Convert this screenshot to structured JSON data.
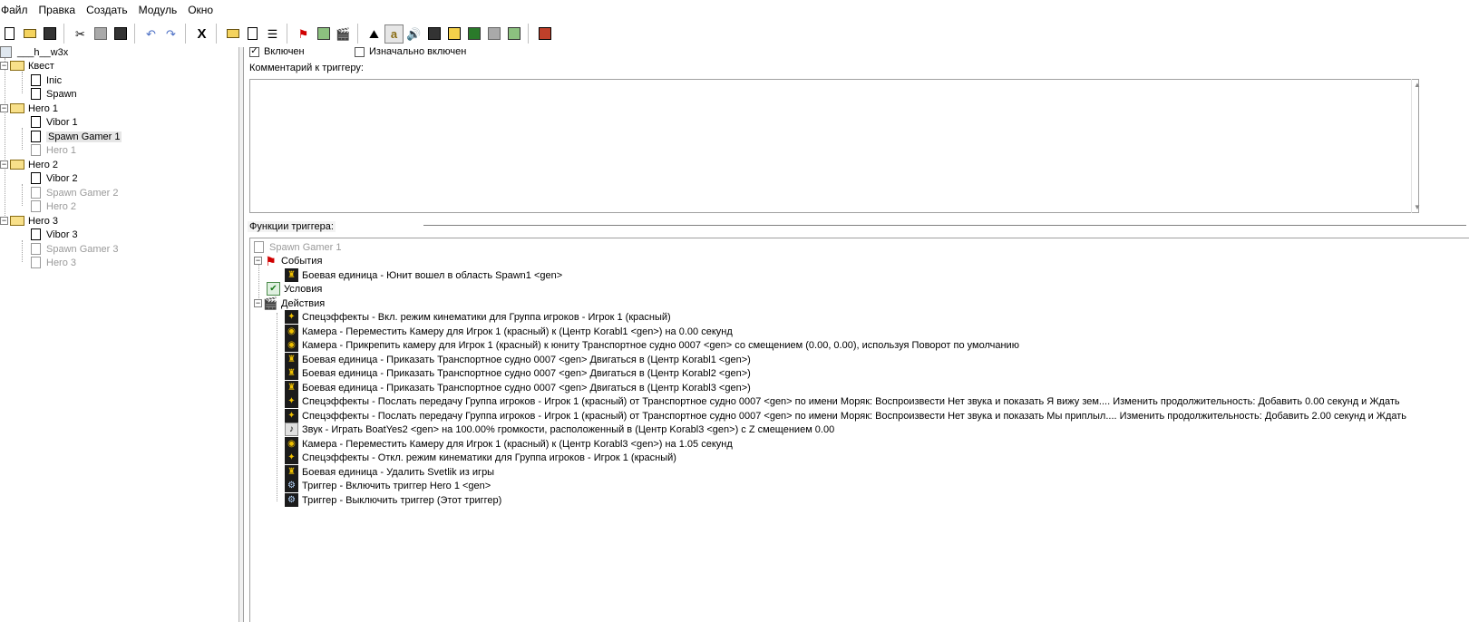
{
  "menu": [
    "Файл",
    "Правка",
    "Создать",
    "Модуль",
    "Окно"
  ],
  "toolbar_icons": [
    "new-icon",
    "open-icon",
    "save-icon",
    "cut-icon",
    "copy-icon",
    "paste-icon",
    "undo-icon",
    "redo-icon",
    "delete-icon",
    "new-category-icon",
    "new-trigger-icon",
    "new-comment-icon",
    "new-event-icon",
    "new-condition-icon",
    "new-action-icon",
    "terrain-editor-icon",
    "trigger-editor-icon",
    "sound-editor-icon",
    "object-editor-icon",
    "campaign-editor-icon",
    "ai-editor-icon",
    "object-manager-icon",
    "import-manager-icon",
    "test-map-icon"
  ],
  "tree": {
    "root": "___h__w3x",
    "categories": [
      {
        "label": "Квест",
        "items": [
          {
            "label": "Inic",
            "enabled": true
          },
          {
            "label": "Spawn",
            "enabled": true
          }
        ]
      },
      {
        "label": "Hero 1",
        "items": [
          {
            "label": "Vibor 1",
            "enabled": true
          },
          {
            "label": "Spawn Gamer 1",
            "enabled": true,
            "selected": true
          },
          {
            "label": "Hero 1",
            "enabled": false
          }
        ]
      },
      {
        "label": "Hero 2",
        "items": [
          {
            "label": "Vibor 2",
            "enabled": true
          },
          {
            "label": "Spawn Gamer 2",
            "enabled": false
          },
          {
            "label": "Hero 2",
            "enabled": false
          }
        ]
      },
      {
        "label": "Hero 3",
        "items": [
          {
            "label": "Vibor 3",
            "enabled": true
          },
          {
            "label": "Spawn Gamer 3",
            "enabled": false
          },
          {
            "label": "Hero 3",
            "enabled": false
          }
        ]
      }
    ]
  },
  "trigger": {
    "enabled_label": "Включен",
    "enabled_checked": true,
    "initially_on_label": "Изначально включен",
    "initially_on_checked": false,
    "comment_label": "Комментарий к триггеру:",
    "comment_value": "",
    "functions_label": "Функции триггера:",
    "name": "Spawn Gamer 1",
    "events_label": "События",
    "conditions_label": "Условия",
    "actions_label": "Действия",
    "events": [
      {
        "icon": "unit-icon",
        "text": "Боевая единица - Юнит вошел в область Spawn1 <gen>"
      }
    ],
    "actions": [
      {
        "icon": "cinematic-icon",
        "text": "Спецэффекты - Вкл. режим кинематики для Группа игроков - Игрок 1 (красный)"
      },
      {
        "icon": "camera-icon",
        "text": "Камера - Переместить Камеру для Игрок 1 (красный) к (Центр Korabl1 <gen>) на 0.00 секунд"
      },
      {
        "icon": "camera-icon",
        "text": "Камера -  Прикрепить камеру для Игрок 1 (красный) к юниту Транспортное судно 0007 <gen> со смещением (0.00, 0.00), используя Поворот по умолчанию"
      },
      {
        "icon": "unit-icon",
        "text": "Боевая единица - Приказать Транспортное судно 0007 <gen> Двигаться в (Центр Korabl1 <gen>)"
      },
      {
        "icon": "unit-icon",
        "text": "Боевая единица - Приказать Транспортное судно 0007 <gen> Двигаться в (Центр Korabl2 <gen>)"
      },
      {
        "icon": "unit-icon",
        "text": "Боевая единица - Приказать Транспортное судно 0007 <gen> Двигаться в (Центр Korabl3 <gen>)"
      },
      {
        "icon": "cinematic-icon",
        "text": "Спецэффекты - Послать передачу Группа игроков - Игрок 1 (красный) от Транспортное судно 0007 <gen> по имени Моряк: Воспроизвести Нет звука и показать Я вижу зем....  Изменить продолжительность: Добавить 0.00 секунд и Ждать"
      },
      {
        "icon": "cinematic-icon",
        "text": "Спецэффекты - Послать передачу Группа игроков - Игрок 1 (красный) от Транспортное судно 0007 <gen> по имени Моряк: Воспроизвести Нет звука и показать Мы приплыл....  Изменить продолжительность: Добавить 2.00 секунд и Ждать"
      },
      {
        "icon": "sound-icon",
        "text": "Звук - Играть BoatYes2 <gen> на 100.00% громкости, расположенный в (Центр Korabl3 <gen>) с Z смещением 0.00"
      },
      {
        "icon": "camera-icon",
        "text": "Камера - Переместить Камеру для Игрок 1 (красный) к (Центр Korabl3 <gen>) на 1.05 секунд"
      },
      {
        "icon": "cinematic-icon",
        "text": "Спецэффекты - Откл. режим кинематики для Группа игроков - Игрок 1 (красный)"
      },
      {
        "icon": "unit-icon",
        "text": "Боевая единица - Удалить Svetlik из игры"
      },
      {
        "icon": "trigger-icon",
        "text": "Триггер - Включить триггер Hero 1 <gen>"
      },
      {
        "icon": "trigger-icon",
        "text": "Триггер - Выключить триггер (Этот триггер)"
      }
    ]
  }
}
